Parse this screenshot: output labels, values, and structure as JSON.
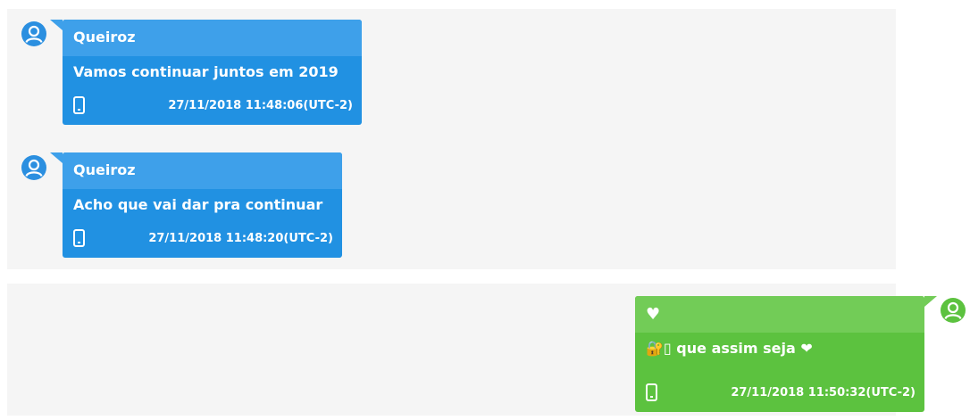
{
  "messages": [
    {
      "sender": "Queiroz",
      "text": "Vamos continuar juntos em 2019",
      "timestamp": "27/11/2018 11:48:06(UTC-2)",
      "device_icon": "phone-icon",
      "avatar_icon": "user-icon"
    },
    {
      "sender": "Queiroz",
      "text": "Acho que vai dar pra continuar",
      "timestamp": "27/11/2018 11:48:20(UTC-2)",
      "device_icon": "phone-icon",
      "avatar_icon": "user-icon"
    },
    {
      "sender": "♥",
      "text_prefix": "🔐▯",
      "text": " que assim seja ❤",
      "timestamp": "27/11/2018 11:50:32(UTC-2)",
      "device_icon": "phone-icon",
      "avatar_icon": "user-icon"
    }
  ],
  "colors": {
    "incoming": "#2191e2",
    "incoming_header": "#3ea0ea",
    "outgoing": "#5cc23f",
    "outgoing_header": "#72cc57",
    "avatar_blue": "#2b8fe0",
    "avatar_green": "#5cc23f",
    "panel": "#f5f5f5"
  }
}
